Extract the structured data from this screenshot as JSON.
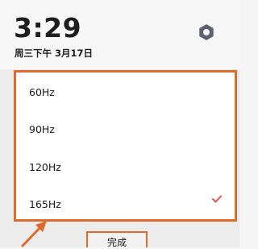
{
  "status": {
    "time": "3:29",
    "date": "周三下午 3月17日"
  },
  "refresh_rate_dialog": {
    "options": [
      {
        "label": "60Hz",
        "selected": false
      },
      {
        "label": "90Hz",
        "selected": false
      },
      {
        "label": "120Hz",
        "selected": false
      },
      {
        "label": "165Hz",
        "selected": true
      }
    ],
    "done_label": "完成"
  },
  "colors": {
    "highlight": "#e0692c",
    "check": "#d9534f",
    "icon": "#5a6270"
  },
  "icons": [
    "settings-hexagon-icon",
    "checkmark-icon",
    "arrow-pointer"
  ]
}
